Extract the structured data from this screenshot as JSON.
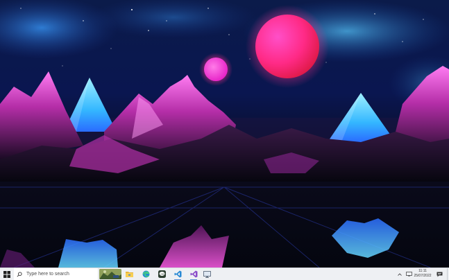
{
  "taskbar": {
    "search_placeholder": "Type here to search",
    "pinned_apps": [
      {
        "name": "File Explorer",
        "icon": "folder-icon"
      },
      {
        "name": "Microsoft Edge",
        "icon": "edge-icon"
      },
      {
        "name": "LINE",
        "icon": "line-chat-icon"
      },
      {
        "name": "Visual Studio Code",
        "icon": "vscode-icon"
      },
      {
        "name": "Visual Studio",
        "icon": "visual-studio-icon"
      },
      {
        "name": "Remote Desktop",
        "icon": "monitor-icon"
      }
    ],
    "clock": {
      "time": "11:11",
      "date": "25/07/2022"
    }
  },
  "colors": {
    "taskbar_bg": "#eef0f3",
    "accent": "#5a8fd6",
    "planet_large": "#ff2f8a",
    "planet_small": "#ff3fd8",
    "pyramid": "#3fc6ff"
  },
  "wallpaper": {
    "description_icon": "synthwave-mountain-wallpaper"
  }
}
